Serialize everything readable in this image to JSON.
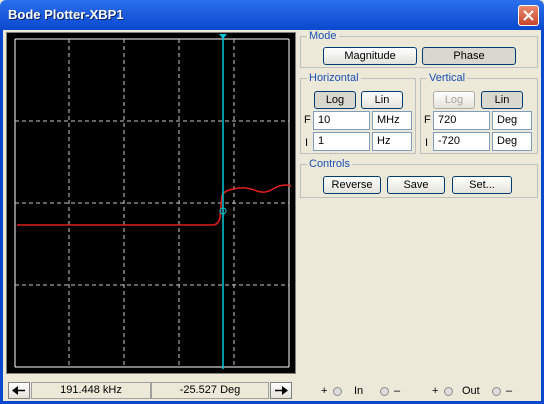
{
  "window": {
    "title": "Bode Plotter-XBP1"
  },
  "mode": {
    "legend": "Mode",
    "magnitude_label": "Magnitude",
    "phase_label": "Phase"
  },
  "horizontal": {
    "legend": "Horizontal",
    "log_label": "Log",
    "lin_label": "Lin",
    "f_label": "F",
    "f_value": "10",
    "f_unit": "MHz",
    "i_label": "I",
    "i_value": "1",
    "i_unit": "Hz"
  },
  "vertical": {
    "legend": "Vertical",
    "log_label": "Log",
    "lin_label": "Lin",
    "f_label": "F",
    "f_value": "720",
    "f_unit": "Deg",
    "i_label": "I",
    "i_value": "-720",
    "i_unit": "Deg"
  },
  "controls": {
    "legend": "Controls",
    "reverse_label": "Reverse",
    "save_label": "Save",
    "set_label": "Set..."
  },
  "status": {
    "frequency": "191.448 kHz",
    "phase": "-25.527 Deg"
  },
  "terminals": {
    "plus": "+",
    "minus": "–",
    "in_label": "In",
    "out_label": "Out"
  },
  "colors": {
    "trace": "#e0201c",
    "cursor": "#00c8d8",
    "grid": "#c8c8c8",
    "background": "#000000"
  },
  "icons": {
    "close": "close-icon",
    "left": "arrow-left-icon",
    "right": "arrow-right-icon"
  }
}
